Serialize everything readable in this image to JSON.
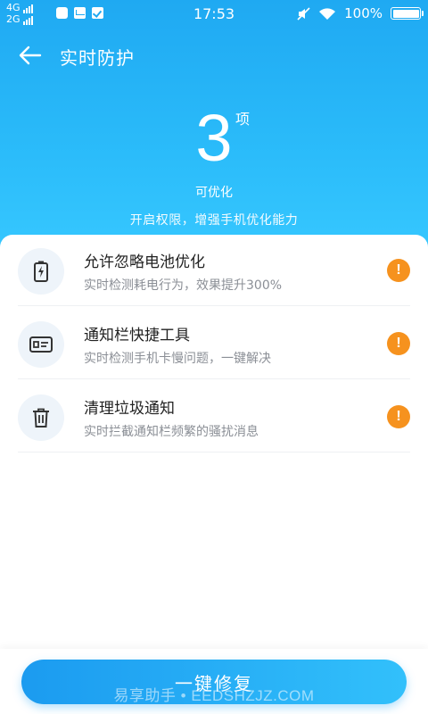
{
  "status_bar": {
    "network_1": "4G",
    "network_2": "2G",
    "time": "17:53",
    "battery": "100%"
  },
  "header": {
    "title": "实时防护",
    "back_icon": "arrow-left-icon"
  },
  "summary": {
    "count": "3",
    "unit": "项",
    "label": "可优化",
    "tip": "开启权限，增强手机优化能力"
  },
  "items": [
    {
      "icon": "battery-charging-icon",
      "title": "允许忽略电池优化",
      "desc": "实时检测耗电行为，效果提升300%",
      "badge": "!"
    },
    {
      "icon": "notification-card-icon",
      "title": "通知栏快捷工具",
      "desc": "实时检测手机卡慢问题，一键解决",
      "badge": "!"
    },
    {
      "icon": "trash-icon",
      "title": "清理垃圾通知",
      "desc": "实时拦截通知栏频繁的骚扰消息",
      "badge": "!"
    }
  ],
  "action": {
    "fix_label": "一键修复"
  },
  "watermark": "易享助手 • EEDSHZJZ.COM",
  "colors": {
    "primary": "#1fa9f2",
    "warning": "#f6921e",
    "icon_bg": "#eef4fa"
  }
}
